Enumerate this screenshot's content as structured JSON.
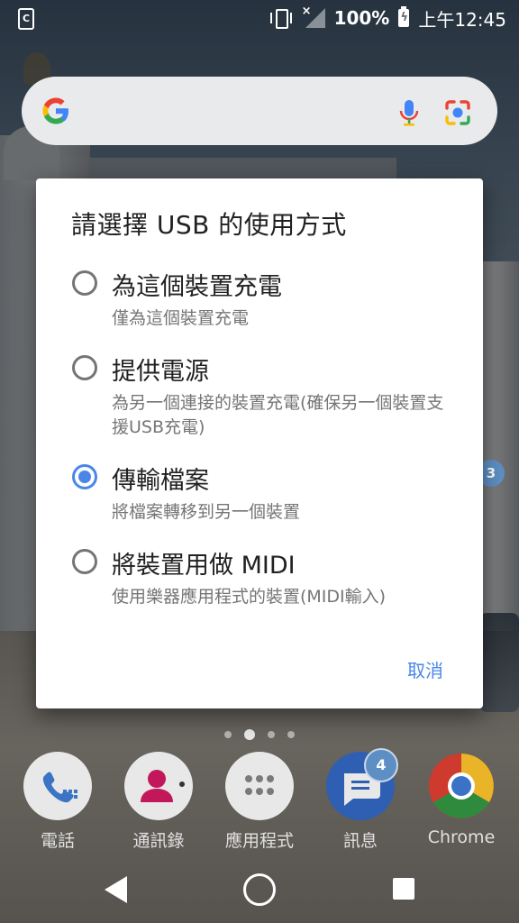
{
  "status_bar": {
    "battery_percent": "100%",
    "time": "上午12:45",
    "icons": [
      "app-notification-icon",
      "vibrate-icon",
      "signal-no-service-icon",
      "battery-charging-icon"
    ]
  },
  "search_bar": {
    "icons": [
      "google-g-icon",
      "microphone-icon",
      "google-lens-icon"
    ]
  },
  "dialog": {
    "title": "請選擇 USB 的使用方式",
    "options": [
      {
        "title": "為這個裝置充電",
        "description": "僅為這個裝置充電",
        "selected": false
      },
      {
        "title": "提供電源",
        "description": "為另一個連接的裝置充電(確保另一個裝置支援USB充電)",
        "selected": false
      },
      {
        "title": "傳輸檔案",
        "description": "將檔案轉移到另一個裝置",
        "selected": true
      },
      {
        "title": "將裝置用做 MIDI",
        "description": "使用樂器應用程式的裝置(MIDI輸入)",
        "selected": false
      }
    ],
    "cancel_label": "取消"
  },
  "home": {
    "page_dots": 4,
    "active_page": 2,
    "side_badge": "3",
    "dock": [
      {
        "label": "電話",
        "icon": "phone-icon"
      },
      {
        "label": "通訊錄",
        "icon": "contacts-icon"
      },
      {
        "label": "應用程式",
        "icon": "app-drawer-icon"
      },
      {
        "label": "訊息",
        "icon": "messages-icon",
        "badge": "4"
      },
      {
        "label": "Chrome",
        "icon": "chrome-icon"
      }
    ]
  },
  "colors": {
    "accent": "#4a86e8",
    "dialog_bg": "#ffffff",
    "text_primary": "#212121",
    "text_secondary": "#757575"
  }
}
